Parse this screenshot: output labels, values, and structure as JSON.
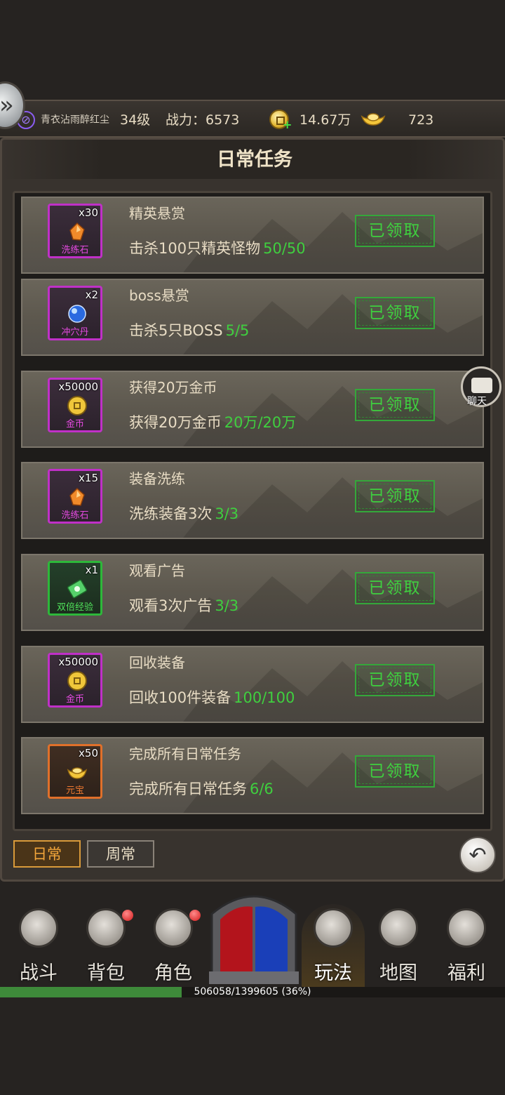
{
  "header": {
    "player_name": "青衣沾雨醉红尘",
    "level": "34级",
    "power": "战力：6573",
    "gold": "14.67万",
    "ingots": "723",
    "rank_icon": "purple-rank-icon",
    "gold_icon": "coin-icon",
    "ingot_icon": "ingot-icon"
  },
  "panel": {
    "title": "日常任务"
  },
  "tasks": [
    {
      "title": "精英悬赏",
      "desc": "击杀100只精英怪物",
      "progress": "50/50",
      "reward_qty": "x30",
      "reward_name": "洗练石",
      "reward_icon": "orange-stone-icon",
      "rarity": "purple",
      "button": "已领取"
    },
    {
      "title": "boss悬赏",
      "desc": "击杀5只BOSS",
      "progress": "5/5",
      "reward_qty": "x2",
      "reward_name": "冲穴丹",
      "reward_icon": "blue-orb-icon",
      "rarity": "purple",
      "button": "已领取"
    },
    {
      "title": "获得20万金币",
      "desc": "获得20万金币",
      "progress": "20万/20万",
      "reward_qty": "x50000",
      "reward_name": "金币",
      "reward_icon": "coin-icon",
      "rarity": "purple",
      "button": "已领取"
    },
    {
      "title": "装备洗练",
      "desc": "洗练装备3次",
      "progress": "3/3",
      "reward_qty": "x15",
      "reward_name": "洗练石",
      "reward_icon": "orange-stone-icon",
      "rarity": "purple",
      "button": "已领取"
    },
    {
      "title": "观看广告",
      "desc": "观看3次广告",
      "progress": "3/3",
      "reward_qty": "x1",
      "reward_name": "双倍经验",
      "reward_icon": "exp-scroll-icon",
      "rarity": "green",
      "button": "已领取"
    },
    {
      "title": "回收装备",
      "desc": "回收100件装备",
      "progress": "100/100",
      "reward_qty": "x50000",
      "reward_name": "金币",
      "reward_icon": "coin-icon",
      "rarity": "purple",
      "button": "已领取"
    },
    {
      "title": "完成所有日常任务",
      "desc": "完成所有日常任务",
      "progress": "6/6",
      "reward_qty": "x50",
      "reward_name": "元宝",
      "reward_icon": "ingot-icon",
      "rarity": "orange",
      "button": "已领取"
    }
  ],
  "chat": {
    "label": "聊天"
  },
  "tabs": {
    "daily": "日常",
    "weekly": "周常",
    "active": "daily"
  },
  "nav": {
    "items": [
      {
        "label": "战斗",
        "icon": "crossed-swords-icon",
        "badge": false
      },
      {
        "label": "背包",
        "icon": "backpack-icon",
        "badge": true
      },
      {
        "label": "角色",
        "icon": "helmet-icon",
        "badge": true
      },
      {
        "label": "玩法",
        "icon": "sword-icon",
        "badge": false,
        "active": true
      },
      {
        "label": "地图",
        "icon": "map-icon",
        "badge": false
      },
      {
        "label": "福利",
        "icon": "chest-icon",
        "badge": false
      }
    ]
  },
  "exp": {
    "text": "506058/1399605 (36%)",
    "fraction": 0.36
  },
  "colors": {
    "progress_green": "#3fcf3f",
    "purple_rarity": "#c030c8",
    "green_rarity": "#2db83a",
    "orange_rarity": "#e0702a",
    "tab_active": "#f2a53a"
  }
}
